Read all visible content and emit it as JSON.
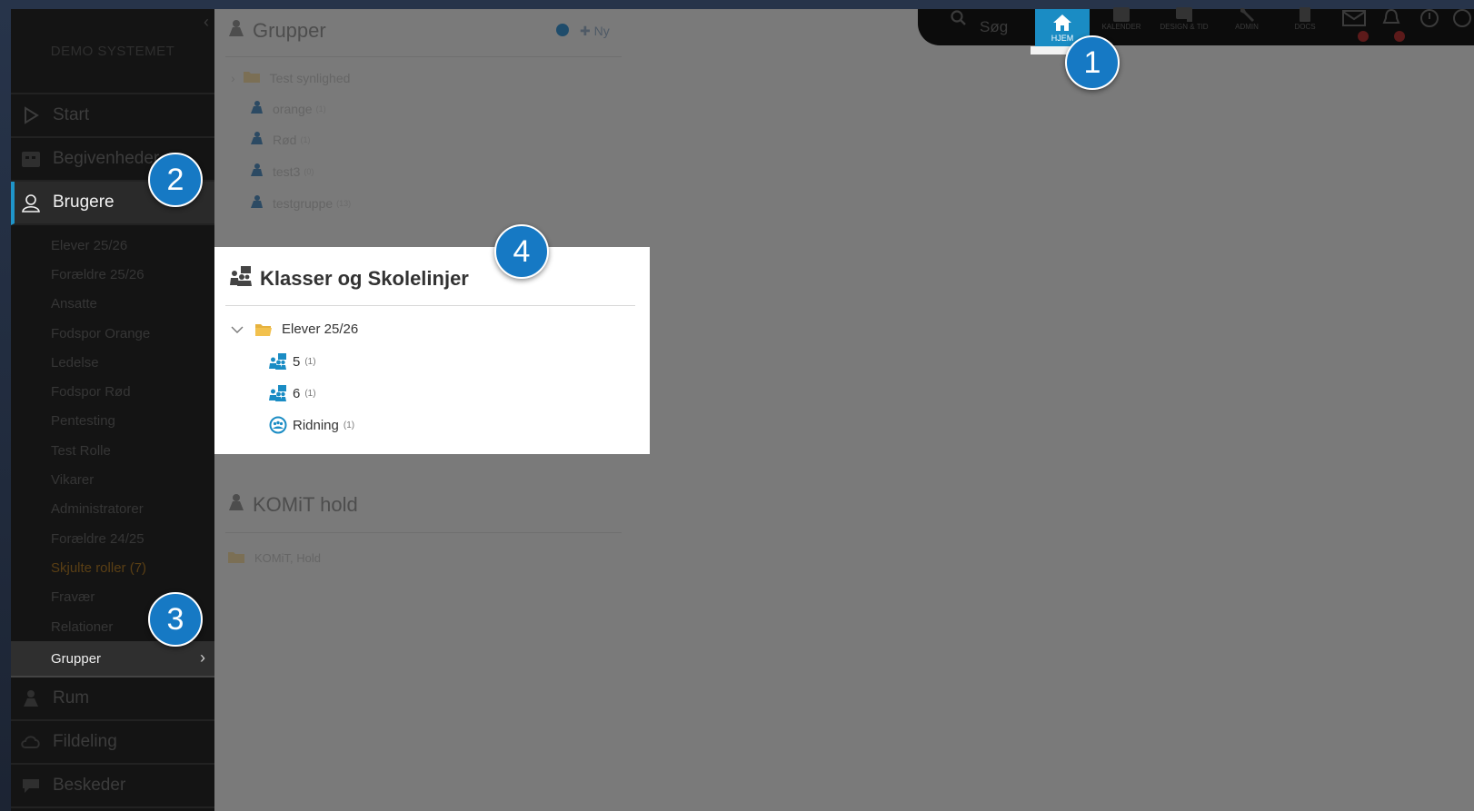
{
  "sidebar": {
    "brand": "DEMO SYSTEMET",
    "nav": [
      {
        "label": "Start",
        "icon": "play-icon"
      },
      {
        "label": "Begivenheder",
        "icon": "calendar-icon"
      },
      {
        "label": "Brugere",
        "icon": "user-icon"
      }
    ],
    "sub_items": [
      "Elever 25/26",
      "Forældre 25/26",
      "Ansatte",
      "Fodspor Orange",
      "Ledelse",
      "Fodspor Rød",
      "Pentesting",
      "Test Rolle",
      "Vikarer",
      "Administratorer",
      "Forældre 24/25",
      "Skjulte roller (7)",
      "Fravær",
      "Relationer"
    ],
    "active_sub": "Grupper",
    "nav_bottom": [
      {
        "label": "Rum",
        "icon": "people-icon"
      },
      {
        "label": "Fildeling",
        "icon": "cloud-icon"
      },
      {
        "label": "Beskeder",
        "icon": "chat-icon"
      }
    ]
  },
  "grupper": {
    "title": "Grupper",
    "new_label": "Ny",
    "items": [
      {
        "label": "Test synlighed",
        "count": ""
      },
      {
        "label": "orange",
        "count": "(1)"
      },
      {
        "label": "Rød",
        "count": "(1)"
      },
      {
        "label": "test3",
        "count": "(0)"
      },
      {
        "label": "testgruppe",
        "count": "(13)"
      }
    ]
  },
  "klasser": {
    "title": "Klasser og Skolelinjer",
    "folder": "Elever 25/26",
    "items": [
      {
        "label": "5",
        "count": "(1)",
        "icon": "class-icon"
      },
      {
        "label": "6",
        "count": "(1)",
        "icon": "class-icon"
      },
      {
        "label": "Ridning",
        "count": "(1)",
        "icon": "team-icon"
      }
    ]
  },
  "komit": {
    "title": "KOMiT hold",
    "folder": "KOMiT, Hold"
  },
  "topbar": {
    "search": "Søg",
    "home": "HJEM",
    "items": [
      "KALENDER",
      "DESIGN & TID",
      "ADMIN",
      "DOCS"
    ]
  },
  "markers": [
    "1",
    "2",
    "3",
    "4"
  ],
  "colors": {
    "accent": "#1a8cc4",
    "marker": "#1679c4",
    "folder": "#f2c14e"
  }
}
